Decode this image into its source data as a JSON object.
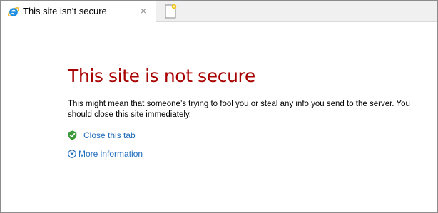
{
  "tab": {
    "title": "This site isn’t secure",
    "close_glyph": "×",
    "icon": "internet-explorer-icon"
  },
  "newtab": {
    "icon": "new-tab-icon"
  },
  "page": {
    "heading": "This site is not secure",
    "message": "This might mean that someone’s trying to fool you or steal any info you send to the server. You should close this site immediately.",
    "close_tab_label": "Close this tab",
    "close_tab_icon": "green-shield-check-icon",
    "more_info_label": "More information",
    "more_info_icon": "expand-circle-icon"
  },
  "colors": {
    "heading": "#a80000",
    "link": "#1f6dbe",
    "shield": "#3a9a3a"
  }
}
